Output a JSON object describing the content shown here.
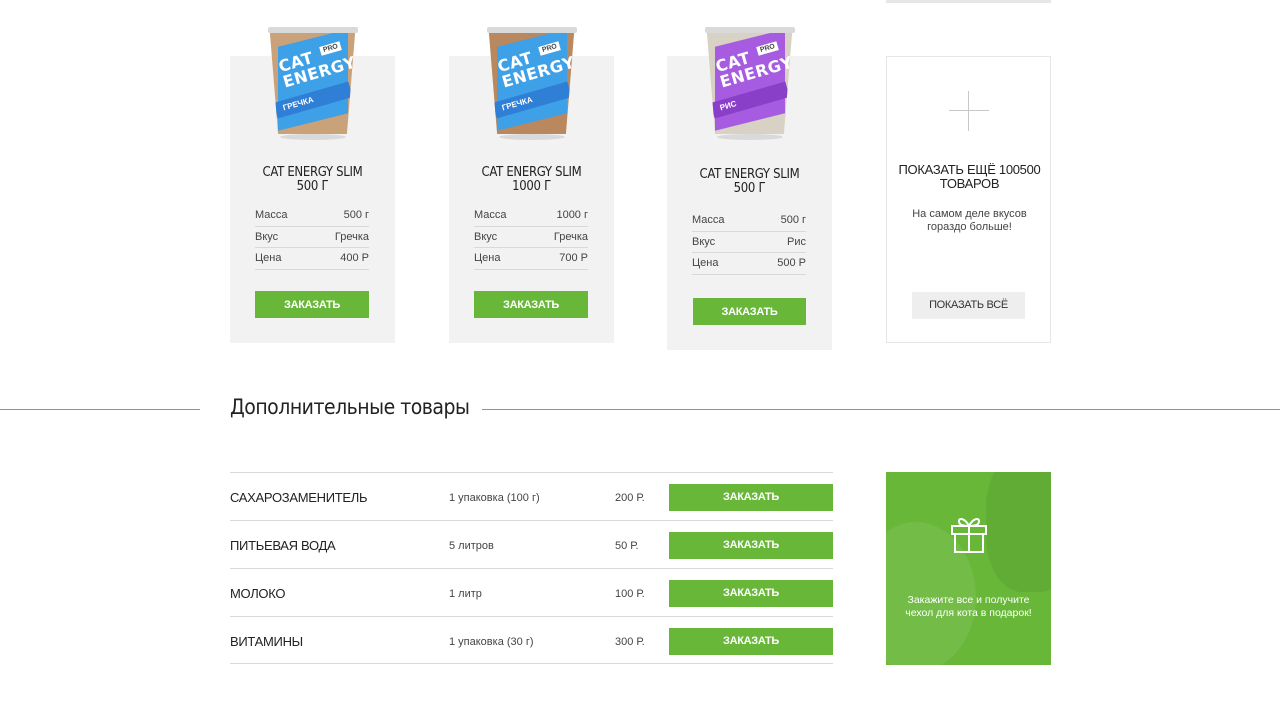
{
  "products": [
    {
      "title_line1": "CAT ENERGY SLIM",
      "title_line2": "500 Г",
      "pack": {
        "badge": "PRO",
        "brand_line1": "CAT",
        "brand_line2": "ENERGY",
        "flavor": "ГРЕЧКА",
        "band_color": "#2f7fd6",
        "label_color": "#3ea0e6",
        "content_color": "#c9a27a"
      },
      "specs": [
        {
          "label": "Масса",
          "value": "500 г"
        },
        {
          "label": "Вкус",
          "value": "Гречка"
        },
        {
          "label": "Цена",
          "value": "400 Р"
        }
      ],
      "order_label": "ЗАКАЗАТЬ"
    },
    {
      "title_line1": "CAT ENERGY SLIM",
      "title_line2": "1000 Г",
      "pack": {
        "badge": "PRO",
        "brand_line1": "CAT",
        "brand_line2": "ENERGY",
        "flavor": "ГРЕЧКА",
        "band_color": "#2f7fd6",
        "label_color": "#3ea0e6",
        "content_color": "#b9885e"
      },
      "specs": [
        {
          "label": "Масса",
          "value": "1000 г"
        },
        {
          "label": "Вкус",
          "value": "Гречка"
        },
        {
          "label": "Цена",
          "value": "700 Р"
        }
      ],
      "order_label": "ЗАКАЗАТЬ"
    },
    {
      "title_line1": "CAT ENERGY SLIM",
      "title_line2": "500 Г",
      "pack": {
        "badge": "PRO",
        "brand_line1": "CAT",
        "brand_line2": "ENERGY",
        "flavor": "РИС",
        "band_color": "#8a3fc9",
        "label_color": "#a65be0",
        "content_color": "#d8d2c4"
      },
      "specs": [
        {
          "label": "Масса",
          "value": "500 г"
        },
        {
          "label": "Вкус",
          "value": "Рис"
        },
        {
          "label": "Цена",
          "value": "500 Р"
        }
      ],
      "order_label": "ЗАКАЗАТЬ"
    }
  ],
  "more": {
    "title": "ПОКАЗАТЬ ЕЩЁ 100500 ТОВАРОВ",
    "text": "На самом деле вкусов гораздо больше!",
    "button": "ПОКАЗАТЬ ВСЁ"
  },
  "extra_section": {
    "title": "Дополнительные товары",
    "items": [
      {
        "name": "САХАРОЗАМЕНИТЕЛЬ",
        "amount": "1 упаковка (100 г)",
        "price": "200 Р.",
        "order_label": "ЗАКАЗАТЬ"
      },
      {
        "name": "ПИТЬЕВАЯ ВОДА",
        "amount": "5 литров",
        "price": "50 Р.",
        "order_label": "ЗАКАЗАТЬ"
      },
      {
        "name": "МОЛОКО",
        "amount": "1 литр",
        "price": "100 Р.",
        "order_label": "ЗАКАЗАТЬ"
      },
      {
        "name": "ВИТАМИНЫ",
        "amount": "1 упаковка (30 г)",
        "price": "300 Р.",
        "order_label": "ЗАКАЗАТЬ"
      }
    ]
  },
  "promo": {
    "icon": "gift-icon",
    "text": "Закажите все и получите чехол для кота в подарок!"
  },
  "colors": {
    "accent_green": "#68b738",
    "card_bg": "#f2f2f2"
  }
}
